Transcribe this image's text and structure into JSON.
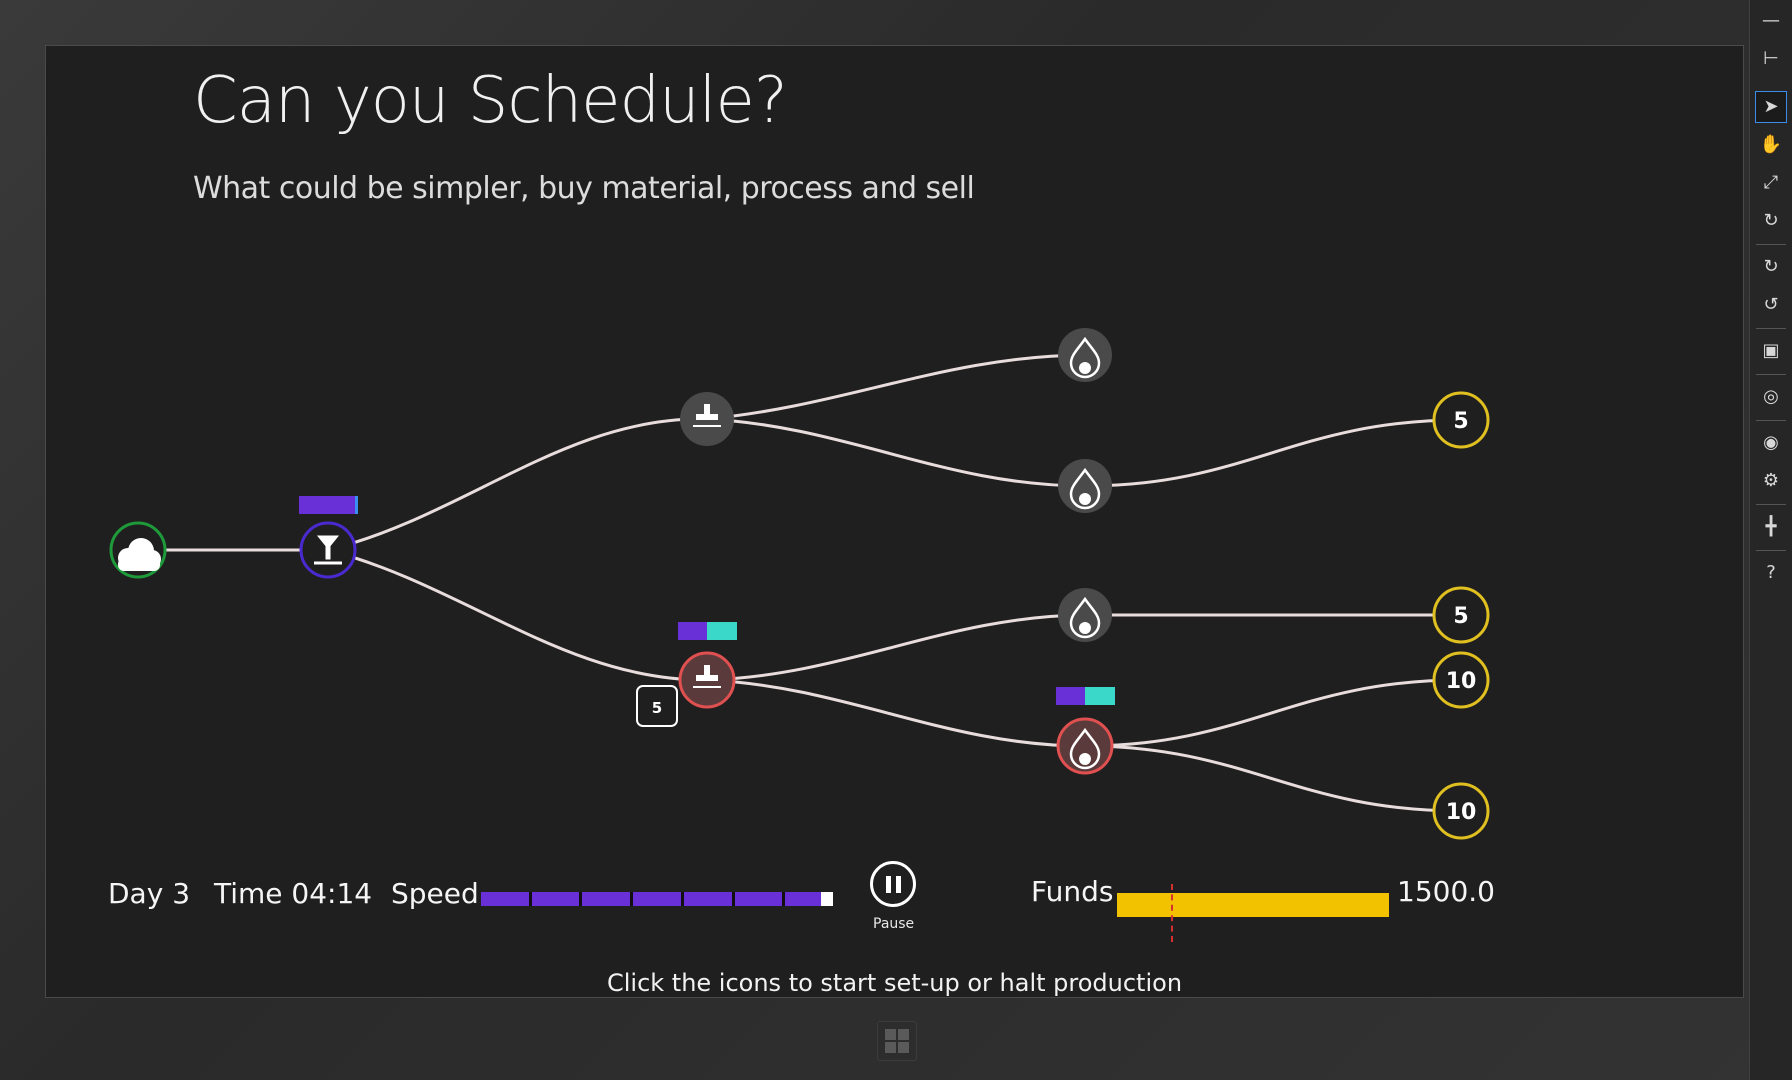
{
  "header": {
    "title": "Can you Schedule?",
    "subtitle": "What could be simpler, buy material, process and sell"
  },
  "status": {
    "day": "Day 3",
    "time": "Time 04:14",
    "speed_label": "Speed",
    "speed_level": 1.0,
    "pause_label": "Pause",
    "funds_label": "Funds",
    "funds_value": "1500.0",
    "hint": "Click the icons to start set-up or halt production"
  },
  "graph": {
    "sources": [
      {
        "icon": "cloud-icon"
      }
    ],
    "machines": [
      {
        "icon": "press-icon",
        "state": "running"
      },
      {
        "icon": "stamp-icon",
        "state": "idle"
      },
      {
        "icon": "stamp-icon",
        "state": "setup"
      },
      {
        "icon": "drop-icon",
        "state": "idle"
      },
      {
        "icon": "drop-icon",
        "state": "idle"
      },
      {
        "icon": "drop-icon",
        "state": "idle"
      },
      {
        "icon": "drop-icon",
        "state": "setup"
      }
    ],
    "stock_badge": "5",
    "sinks": [
      {
        "value": "5"
      },
      {
        "value": "5"
      },
      {
        "value": "10"
      },
      {
        "value": "10"
      }
    ]
  },
  "colors": {
    "accent_purple": "#6a30d8",
    "accent_teal": "#3ad8c8",
    "sink_ring": "#e0c020",
    "setup_ring": "#e05050",
    "funds": "#f2c200"
  },
  "sidebar": {
    "items": [
      "minimize-icon",
      "pin-icon",
      "pointer-icon",
      "hand-icon",
      "zoom-icon",
      "rotate-icon",
      "refresh-icon",
      "undo-icon",
      "monitor-icon",
      "globe-icon",
      "camera-icon",
      "gear-icon",
      "network-icon",
      "help-icon"
    ]
  }
}
